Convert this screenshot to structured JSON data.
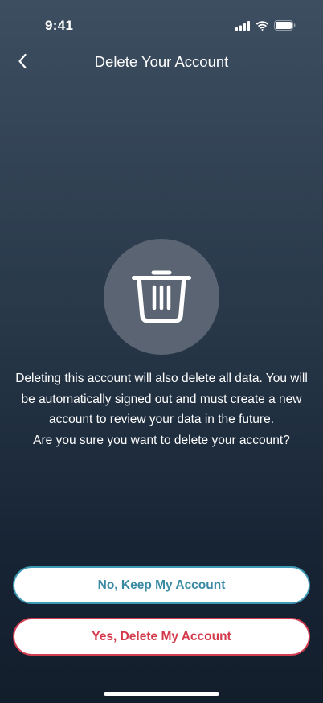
{
  "status_bar": {
    "time": "9:41",
    "icons": [
      "cellular-signal-icon",
      "wifi-icon",
      "battery-icon"
    ]
  },
  "nav": {
    "back_icon": "chevron-left-icon",
    "title": "Delete Your Account"
  },
  "hero": {
    "icon": "trash-icon"
  },
  "message": {
    "line1": "Deleting this account will also delete all data. You will be automatically signed out and must create a new account to review your data in the future.",
    "line2": "Are you sure you want to delete your account?"
  },
  "actions": {
    "keep_label": "No, Keep My Account",
    "delete_label": "Yes, Delete My Account"
  },
  "colors": {
    "keep_accent": "#3a8aa4",
    "delete_accent": "#d33a4c",
    "background_top": "#3d4e61",
    "background_bottom": "#131e2c",
    "icon_circle": "#5a6472"
  }
}
